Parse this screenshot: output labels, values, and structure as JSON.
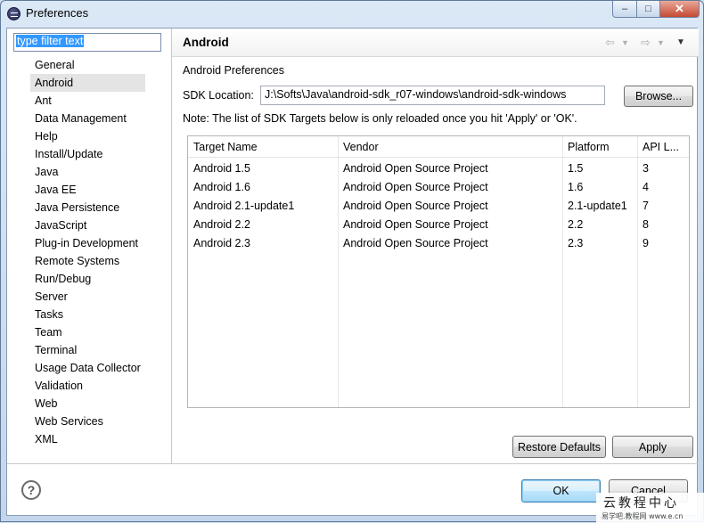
{
  "window": {
    "title": "Preferences"
  },
  "filter": {
    "value": "type filter text"
  },
  "nav": {
    "items": [
      {
        "label": "General"
      },
      {
        "label": "Android",
        "selected": true
      },
      {
        "label": "Ant"
      },
      {
        "label": "Data Management"
      },
      {
        "label": "Help"
      },
      {
        "label": "Install/Update"
      },
      {
        "label": "Java"
      },
      {
        "label": "Java EE"
      },
      {
        "label": "Java Persistence"
      },
      {
        "label": "JavaScript"
      },
      {
        "label": "Plug-in Development"
      },
      {
        "label": "Remote Systems"
      },
      {
        "label": "Run/Debug"
      },
      {
        "label": "Server"
      },
      {
        "label": "Tasks"
      },
      {
        "label": "Team"
      },
      {
        "label": "Terminal"
      },
      {
        "label": "Usage Data Collector"
      },
      {
        "label": "Validation"
      },
      {
        "label": "Web"
      },
      {
        "label": "Web Services"
      },
      {
        "label": "XML"
      }
    ]
  },
  "page": {
    "title": "Android",
    "subtitle": "Android Preferences",
    "sdk_label": "SDK Location:",
    "sdk_value": "J:\\Softs\\Java\\android-sdk_r07-windows\\android-sdk-windows",
    "browse_label": "Browse...",
    "note": "Note: The list of SDK Targets below is only reloaded once you hit 'Apply' or 'OK'."
  },
  "table": {
    "columns": [
      "Target Name",
      "Vendor",
      "Platform",
      "API L..."
    ],
    "rows": [
      [
        "Android 1.5",
        "Android Open Source Project",
        "1.5",
        "3"
      ],
      [
        "Android 1.6",
        "Android Open Source Project",
        "1.6",
        "4"
      ],
      [
        "Android 2.1-update1",
        "Android Open Source Project",
        "2.1-update1",
        "7"
      ],
      [
        "Android 2.2",
        "Android Open Source Project",
        "2.2",
        "8"
      ],
      [
        "Android 2.3",
        "Android Open Source Project",
        "2.3",
        "9"
      ]
    ]
  },
  "buttons": {
    "restore_defaults": "Restore Defaults",
    "apply": "Apply",
    "ok": "OK",
    "cancel": "Cancel"
  },
  "watermark": {
    "main": "云教程中心",
    "sub": "易学吧.教程网 www.e.cn"
  },
  "icons": {
    "back": "back-arrow-icon",
    "forward": "forward-arrow-icon",
    "menu": "view-menu-icon",
    "help": "help-icon"
  }
}
